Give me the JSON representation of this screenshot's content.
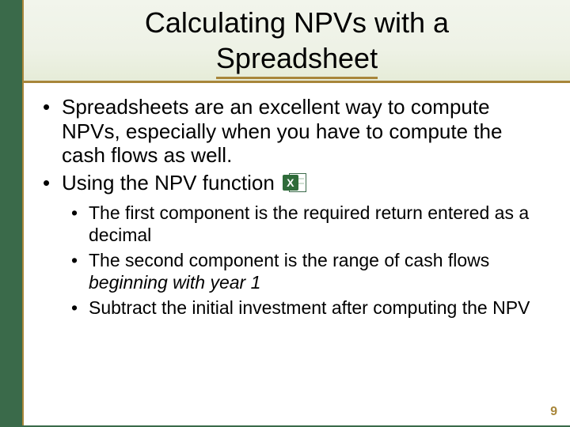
{
  "title_line1": "Calculating NPVs with a",
  "title_line2": "Spreadsheet",
  "bullets_l1": [
    "Spreadsheets are an excellent way to compute NPVs, especially when you have to compute the cash flows as well.",
    "Using the NPV function"
  ],
  "bullets_l2": [
    {
      "plain": "The first component is the required return entered as a decimal",
      "em": ""
    },
    {
      "plain": "The second component is the range of cash flows ",
      "em": "beginning with year 1"
    },
    {
      "plain": "Subtract the initial investment after computing the NPV",
      "em": ""
    }
  ],
  "icon_name": "excel-icon",
  "icon_letter": "X",
  "page_number": "9",
  "colors": {
    "accent_green": "#3a6a4a",
    "accent_gold": "#a8863a",
    "bg_gradient_top": "#f2f5ec",
    "bg_gradient_bottom": "#e6ecd8"
  }
}
